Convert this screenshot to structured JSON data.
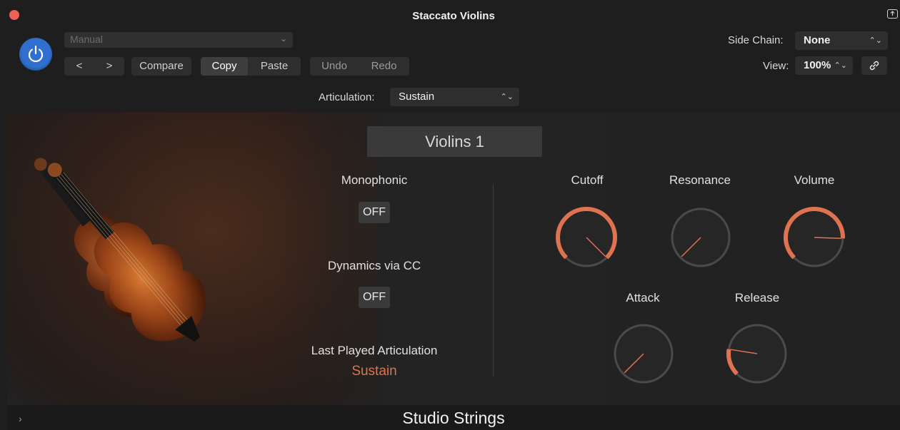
{
  "window": {
    "title": "Staccato Violins"
  },
  "header": {
    "preset": "Manual",
    "nav_prev": "<",
    "nav_next": ">",
    "compare": "Compare",
    "copy": "Copy",
    "paste": "Paste",
    "undo": "Undo",
    "redo": "Redo",
    "side_chain_label": "Side Chain:",
    "side_chain_value": "None",
    "view_label": "View:",
    "view_value": "100%",
    "articulation_label": "Articulation:",
    "articulation_value": "Sustain"
  },
  "panel": {
    "instrument_name": "Violins 1",
    "monophonic_label": "Monophonic",
    "monophonic_value": "OFF",
    "dynamics_label": "Dynamics via CC",
    "dynamics_value": "OFF",
    "last_articulation_label": "Last Played Articulation",
    "last_articulation_value": "Sustain"
  },
  "knobs": [
    {
      "id": "cutoff",
      "label": "Cutoff",
      "value": 1.0
    },
    {
      "id": "resonance",
      "label": "Resonance",
      "value": 0.0
    },
    {
      "id": "volume",
      "label": "Volume",
      "value": 0.84
    },
    {
      "id": "attack",
      "label": "Attack",
      "value": 0.0
    },
    {
      "id": "release",
      "label": "Release",
      "value": 0.2
    }
  ],
  "footer": {
    "title": "Studio Strings"
  },
  "colors": {
    "accent": "#e0734f",
    "power": "#2f6fcf"
  },
  "icons": [
    "power-icon",
    "link-icon",
    "chevron-down-icon",
    "expand-icon"
  ]
}
